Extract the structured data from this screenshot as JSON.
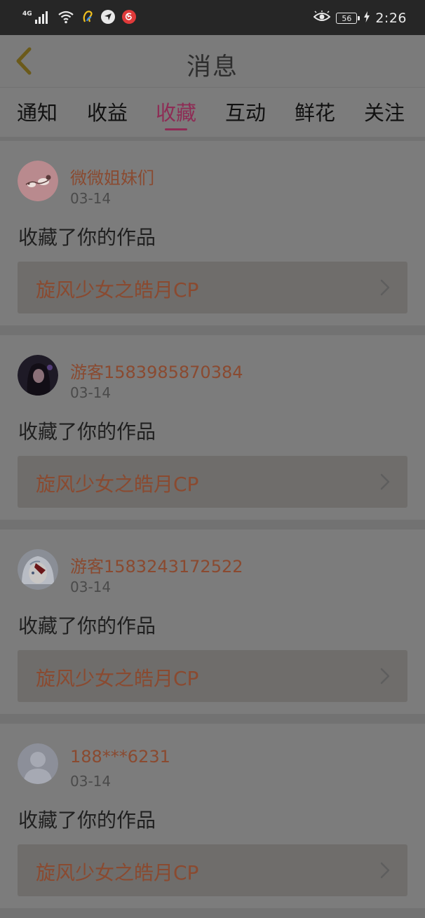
{
  "status_bar": {
    "network_type": "4G",
    "battery_level": "56",
    "time": "2:26",
    "icons": [
      "signal-icon",
      "wifi-icon",
      "app-notification-icon",
      "location-arrow-icon",
      "netease-music-icon",
      "eye-icon",
      "battery-icon",
      "charging-icon"
    ]
  },
  "header": {
    "title": "消息",
    "back_icon": "chevron-left-icon"
  },
  "tabs": [
    {
      "label": "通知",
      "active": false
    },
    {
      "label": "收益",
      "active": false
    },
    {
      "label": "收藏",
      "active": true
    },
    {
      "label": "互动",
      "active": false
    },
    {
      "label": "鲜花",
      "active": false
    },
    {
      "label": "关注",
      "active": false
    }
  ],
  "notifications": [
    {
      "username": "微微姐妹们",
      "date": "03-14",
      "action": "收藏了你的作品",
      "work_title": "旋风少女之皓月CP",
      "avatar": "pink-cartoon-avatar"
    },
    {
      "username": "游客1583985870384",
      "date": "03-14",
      "action": "收藏了你的作品",
      "work_title": "旋风少女之皓月CP",
      "avatar": "dark-girl-avatar"
    },
    {
      "username": "游客1583243172522",
      "date": "03-14",
      "action": "收藏了你的作品",
      "work_title": "旋风少女之皓月CP",
      "avatar": "anime-girl-avatar"
    },
    {
      "username": "188***6231",
      "date": "03-14",
      "action": "收藏了你的作品",
      "work_title": "旋风少女之皓月CP",
      "avatar": "default-user-avatar"
    }
  ],
  "colors": {
    "overlay_bg": "#7c7c7c",
    "status_bar_bg": "#262626",
    "active_tab": "#8e2c55",
    "accent_text": "#8a4a30"
  }
}
